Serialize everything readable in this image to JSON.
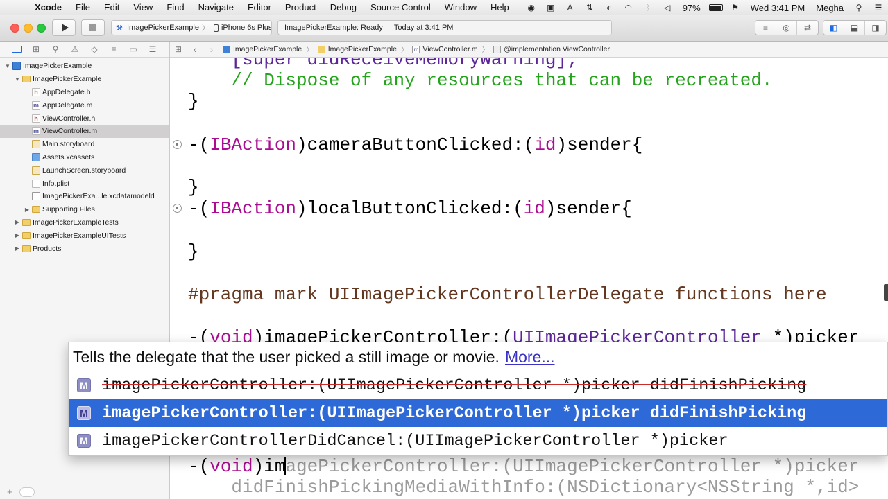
{
  "menubar": {
    "app_name": "Xcode",
    "items": [
      "File",
      "Edit",
      "View",
      "Find",
      "Navigate",
      "Editor",
      "Product",
      "Debug",
      "Source Control",
      "Window",
      "Help"
    ],
    "status": {
      "battery": "97%",
      "clock": "Wed 3:41 PM",
      "user": "Megha"
    }
  },
  "toolbar": {
    "scheme": "ImagePickerExample",
    "device": "iPhone 6s Plus",
    "activity_status": "ImagePickerExample: Ready",
    "activity_time": "Today at 3:41 PM"
  },
  "navigator": {
    "rows": [
      {
        "label": "ImagePickerExample",
        "icon": "project",
        "indent": 0,
        "disclosure": "▼"
      },
      {
        "label": "ImagePickerExample",
        "icon": "folder",
        "indent": 1,
        "disclosure": "▼"
      },
      {
        "label": "AppDelegate.h",
        "icon": "h",
        "indent": 2,
        "disclosure": ""
      },
      {
        "label": "AppDelegate.m",
        "icon": "m",
        "indent": 2,
        "disclosure": ""
      },
      {
        "label": "ViewController.h",
        "icon": "h",
        "indent": 2,
        "disclosure": ""
      },
      {
        "label": "ViewController.m",
        "icon": "m",
        "indent": 2,
        "disclosure": "",
        "selected": true
      },
      {
        "label": "Main.storyboard",
        "icon": "storyboard",
        "indent": 2,
        "disclosure": ""
      },
      {
        "label": "Assets.xcassets",
        "icon": "assets",
        "indent": 2,
        "disclosure": ""
      },
      {
        "label": "LaunchScreen.storyboard",
        "icon": "storyboard",
        "indent": 2,
        "disclosure": ""
      },
      {
        "label": "Info.plist",
        "icon": "plist",
        "indent": 2,
        "disclosure": ""
      },
      {
        "label": "ImagePickerExa...le.xcdatamodeld",
        "icon": "datamodel",
        "indent": 2,
        "disclosure": ""
      },
      {
        "label": "Supporting Files",
        "icon": "folder",
        "indent": 2,
        "disclosure": "▶"
      },
      {
        "label": "ImagePickerExampleTests",
        "icon": "folder",
        "indent": 1,
        "disclosure": "▶"
      },
      {
        "label": "ImagePickerExampleUITests",
        "icon": "folder",
        "indent": 1,
        "disclosure": "▶"
      },
      {
        "label": "Products",
        "icon": "folder",
        "indent": 1,
        "disclosure": "▶"
      }
    ]
  },
  "jumpbar": {
    "crumbs": [
      "ImagePickerExample",
      "ImagePickerExample",
      "ViewController.m",
      "@implementation ViewController"
    ]
  },
  "editor": {
    "line_partial": "    [super didReceiveMemoryWarning];",
    "comment": "    // Dispose of any resources that can be recreated.",
    "close_brace": "}",
    "camera_action": {
      "paren_open": "-(",
      "kw": "IBAction",
      "rest": ")cameraButtonClicked:(",
      "id": "id",
      "tail": ")sender{"
    },
    "local_action": {
      "paren_open": "-(",
      "kw": "IBAction",
      "rest": ")localButtonClicked:(",
      "id": "id",
      "tail": ")sender{"
    },
    "pragma": "#pragma mark UIImagePickerControllerDelegate functions here",
    "method_sig": {
      "a": "-(",
      "kw": "void",
      "b": ")imagePickerController:(",
      "ty": "UIImagePickerController",
      "c": " *)picker"
    },
    "typing_line": {
      "a": "-(",
      "kw": "void",
      "typed": ")im",
      "ghost": "agePickerController:(UIImagePickerController *)picker"
    },
    "ghost_line2": "    didFinishPickingMediaWithInfo:(NSDictionary<NSString *,id>"
  },
  "completion": {
    "description": "Tells the delegate that the user picked a still image or movie.",
    "more_link": "More...",
    "suggestions": [
      {
        "badge": "M",
        "text": "imagePickerController:(UIImagePickerController *)picker didFinishPicking",
        "deprecated": true,
        "highlighted": false
      },
      {
        "badge": "M",
        "text": "imagePickerController:(UIImagePickerController *)picker didFinishPicking",
        "deprecated": false,
        "highlighted": true
      },
      {
        "badge": "M",
        "text": "imagePickerControllerDidCancel:(UIImagePickerController *)picker",
        "deprecated": false,
        "highlighted": false
      }
    ]
  }
}
